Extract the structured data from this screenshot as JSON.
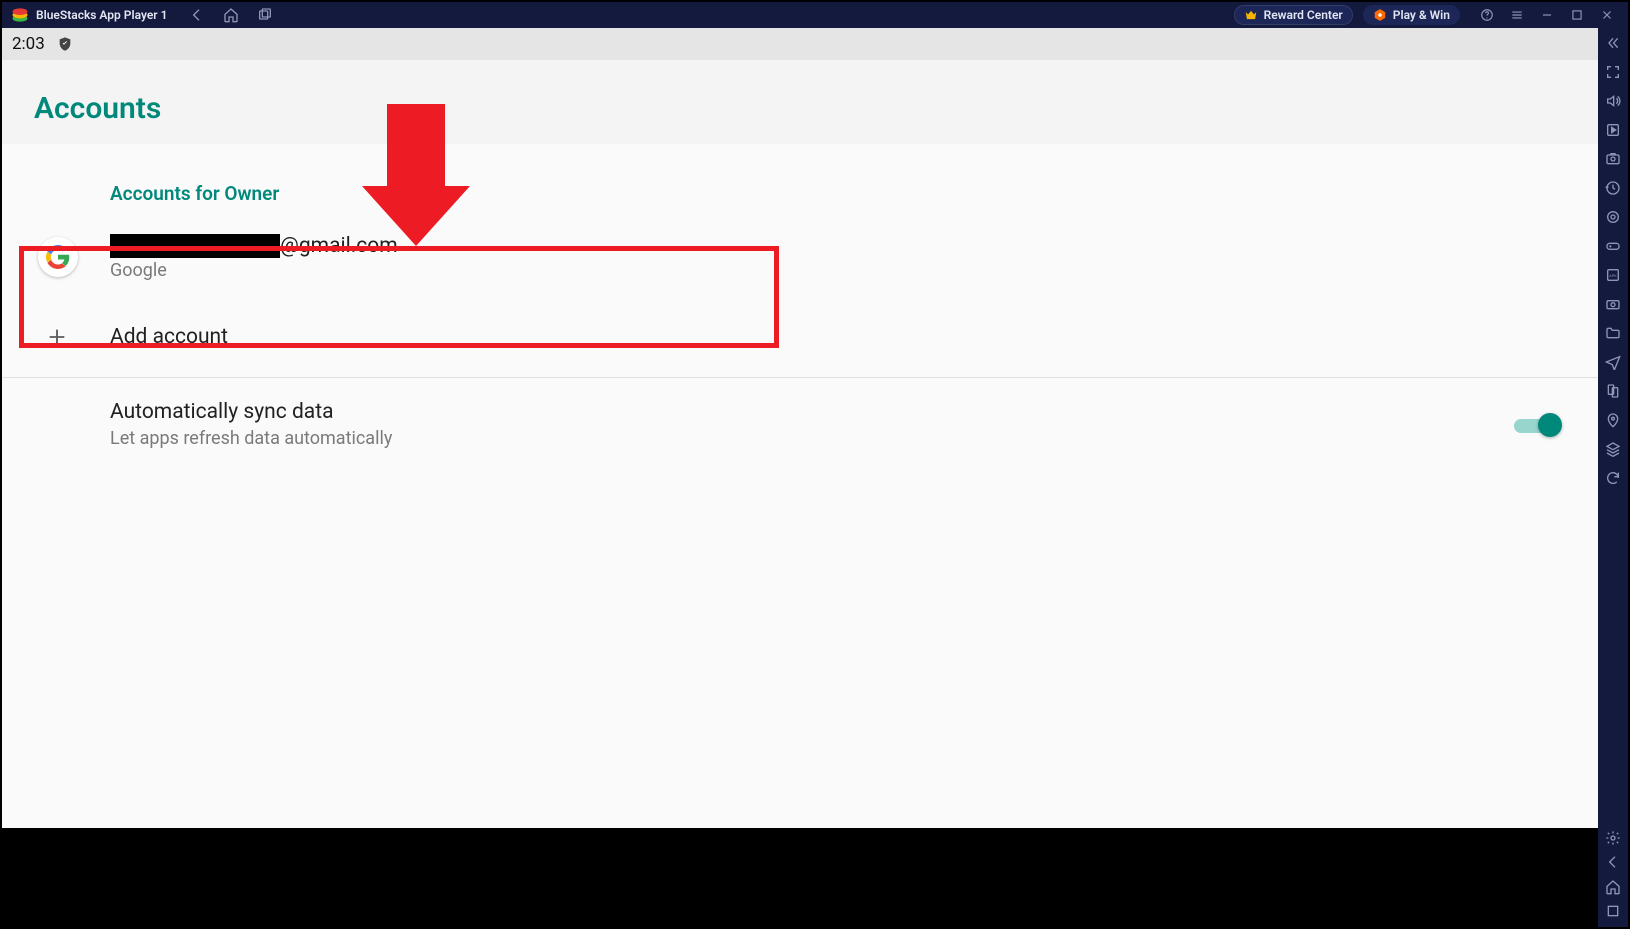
{
  "titlebar": {
    "app_title": "BlueStacks App Player 1",
    "reward_label": "Reward Center",
    "play_label": "Play & Win"
  },
  "status_bar": {
    "time": "2:03"
  },
  "header": {
    "title": "Accounts"
  },
  "accounts": {
    "section_label": "Accounts for Owner",
    "google_account": {
      "email_suffix": "@gmail.com",
      "provider": "Google"
    },
    "add_account_label": "Add account"
  },
  "sync": {
    "title": "Automatically sync data",
    "subtitle": "Let apps refresh data automatically",
    "enabled": true
  },
  "icons": {
    "back": "back-arrow",
    "home": "home",
    "recents": "recents",
    "reward": "crown",
    "play": "hex-dot",
    "help": "help-circle",
    "menu": "hamburger",
    "minimize": "minimize",
    "maximize": "maximize",
    "close": "close",
    "collapse": "chevrons-left",
    "fullscreen": "fullscreen",
    "volume": "volume",
    "media": "play-box",
    "screenshot": "camera-box",
    "history": "history",
    "target": "target",
    "controller": "controller",
    "apk": "apk-box",
    "app-screenshot": "camera",
    "files": "folder",
    "plane": "plane",
    "sync-phone": "sync-phone",
    "location": "location-pin",
    "layers": "layers",
    "rotate": "rotate",
    "settings": "gear",
    "nav-back": "nav-back",
    "nav-home": "nav-home",
    "nav-recents": "nav-recents"
  },
  "colors": {
    "accent": "#00897b",
    "titlebar_bg": "#131a3d",
    "annotation_red": "#ed1c24"
  }
}
